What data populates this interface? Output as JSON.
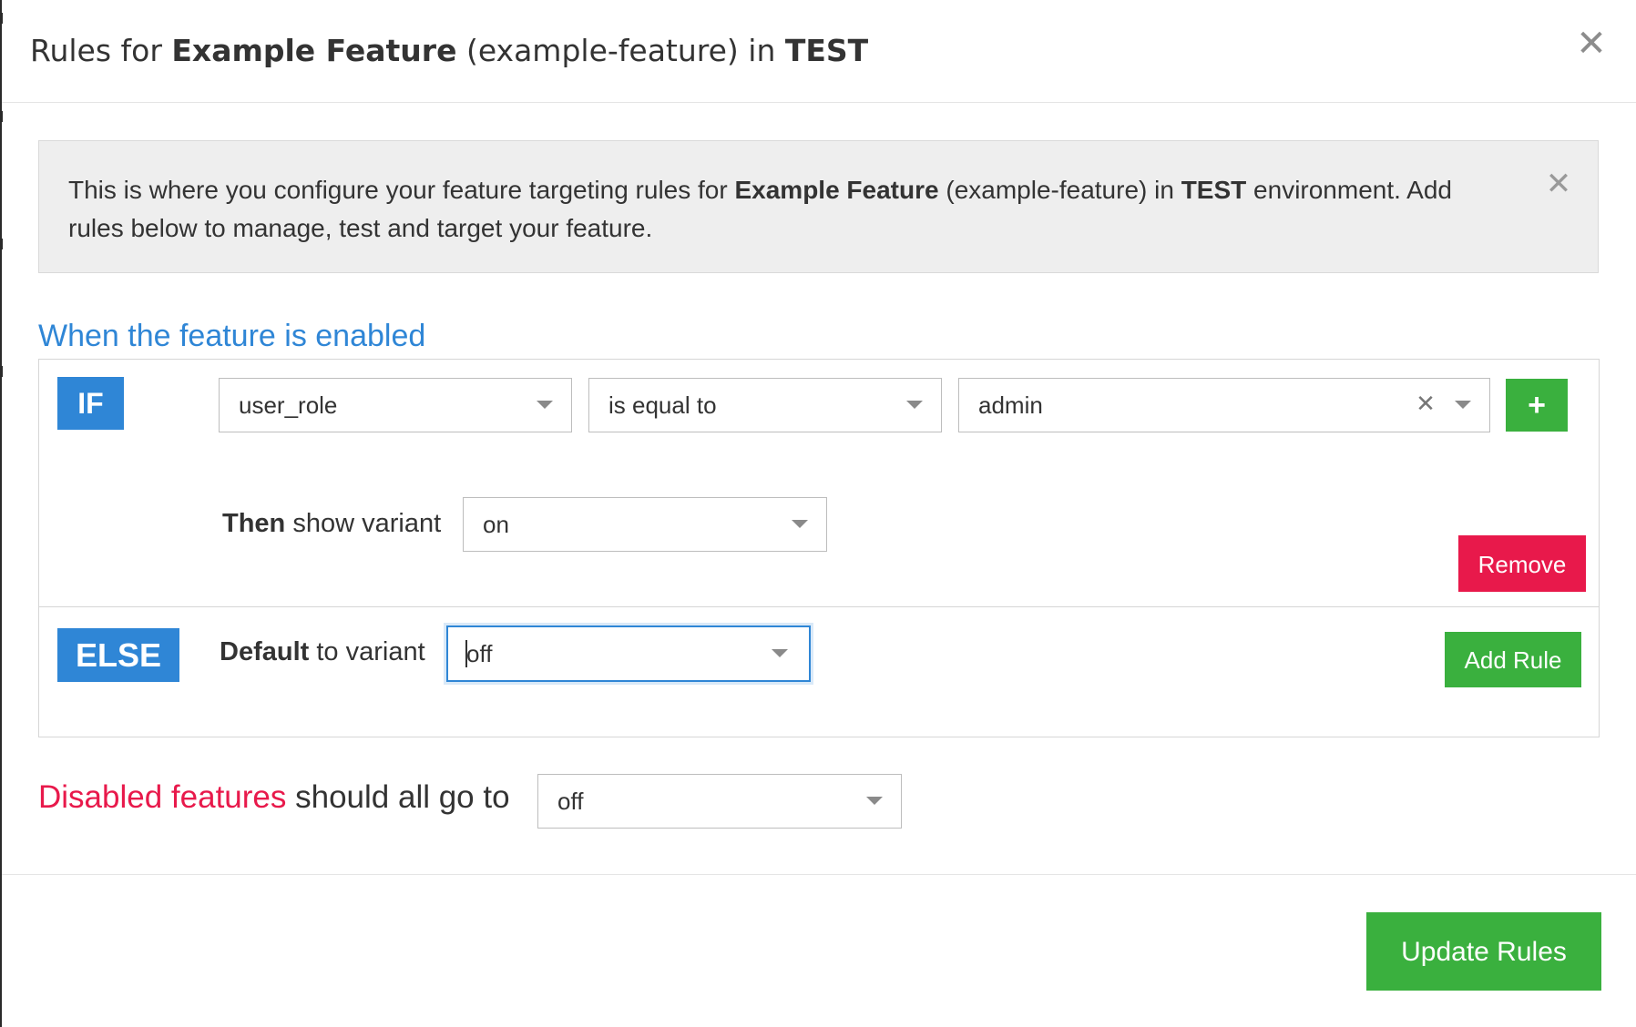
{
  "modal": {
    "title": {
      "prefix": "Rules for ",
      "feature_name": "Example Feature",
      "feature_key": " (example-feature) in ",
      "environment": "TEST"
    },
    "close_icon": "close-icon"
  },
  "alert": {
    "text_before": "This is where you configure your feature targeting rules for ",
    "feature_name": "Example Feature",
    "text_middle": " (example-feature) in ",
    "environment": "TEST",
    "text_after": " environment. Add rules below to manage, test and target your feature.",
    "close_icon": "close-icon"
  },
  "enabled_section": {
    "heading": "When the feature is enabled",
    "if_badge": "IF",
    "rule": {
      "attribute": "user_role",
      "operator": "is equal to",
      "value": "admin",
      "add_condition_label": "+",
      "then_bold": "Then",
      "then_rest": " show variant",
      "then_variant": "on",
      "remove_label": "Remove"
    },
    "else_badge": "ELSE",
    "default_bold": "Default",
    "default_rest": " to variant",
    "default_variant": "off",
    "add_rule_label": "Add Rule"
  },
  "disabled_section": {
    "highlight": "Disabled features",
    "rest": " should all go to",
    "variant": "off"
  },
  "footer": {
    "update_label": "Update Rules"
  },
  "colors": {
    "primary_blue": "#2f86d6",
    "success_green": "#3ab03e",
    "danger_red": "#e8194b",
    "alert_bg": "#eeeeee"
  }
}
